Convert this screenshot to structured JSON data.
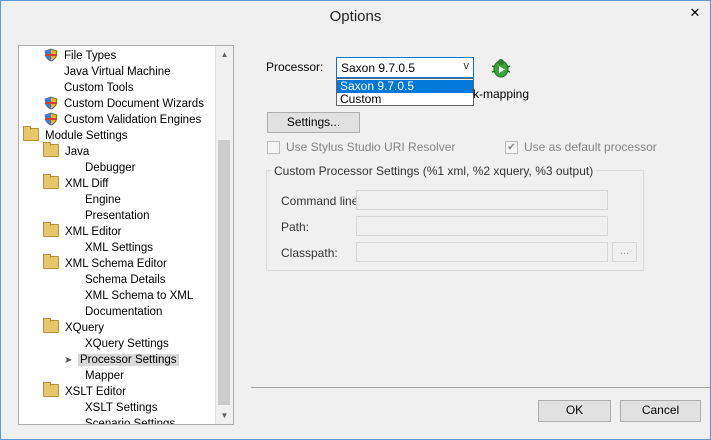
{
  "window": {
    "title": "Options",
    "close_glyph": "✕"
  },
  "tree": {
    "items": [
      {
        "label": "File Types",
        "icon": "shield-icon",
        "indent": 1
      },
      {
        "label": "Java Virtual Machine",
        "icon": "none",
        "indent": 1
      },
      {
        "label": "Custom Tools",
        "icon": "none",
        "indent": 1
      },
      {
        "label": "Custom Document Wizards",
        "icon": "shield-icon",
        "indent": 1
      },
      {
        "label": "Custom Validation Engines",
        "icon": "shield-icon",
        "indent": 1
      },
      {
        "label": "Module Settings",
        "icon": "folder-icon",
        "indent": 0
      },
      {
        "label": "Java",
        "icon": "folder-icon",
        "indent": 1
      },
      {
        "label": "Debugger",
        "icon": "none",
        "indent": 2
      },
      {
        "label": "XML Diff",
        "icon": "folder-icon",
        "indent": 1
      },
      {
        "label": "Engine",
        "icon": "none",
        "indent": 2
      },
      {
        "label": "Presentation",
        "icon": "none",
        "indent": 2
      },
      {
        "label": "XML Editor",
        "icon": "folder-icon",
        "indent": 1
      },
      {
        "label": "XML Settings",
        "icon": "none",
        "indent": 2
      },
      {
        "label": "XML Schema Editor",
        "icon": "folder-icon",
        "indent": 1
      },
      {
        "label": "Schema Details",
        "icon": "none",
        "indent": 2
      },
      {
        "label": "XML Schema to XML",
        "icon": "none",
        "indent": 2
      },
      {
        "label": "Documentation",
        "icon": "none",
        "indent": 2
      },
      {
        "label": "XQuery",
        "icon": "folder-icon",
        "indent": 1
      },
      {
        "label": "XQuery Settings",
        "icon": "none",
        "indent": 2
      },
      {
        "label": "Processor Settings",
        "icon": "arrow-icon",
        "indent": 2,
        "selected": true
      },
      {
        "label": "Mapper",
        "icon": "none",
        "indent": 2
      },
      {
        "label": "XSLT Editor",
        "icon": "folder-icon",
        "indent": 1
      },
      {
        "label": "XSLT Settings",
        "icon": "none",
        "indent": 2
      },
      {
        "label": "Scenario Settings",
        "icon": "none",
        "indent": 2
      }
    ]
  },
  "processor": {
    "label": "Processor:",
    "selected": "Saxon 9.7.0.5",
    "options": [
      "Saxon 9.7.0.5",
      "Custom"
    ],
    "highlighted": "Saxon 9.7.0.5",
    "mapping_label": "k-mapping"
  },
  "settings_button": "Settings...",
  "checkboxes": {
    "uri_resolver": {
      "label": "Use Stylus Studio URI Resolver",
      "checked": false
    },
    "default_processor": {
      "label": "Use as default processor",
      "checked": true
    }
  },
  "custom_group": {
    "title": "Custom Processor Settings (%1 xml, %2 xquery, %3 output)",
    "command_line_label": "Command line:",
    "path_label": "Path:",
    "classpath_label": "Classpath:",
    "browse_label": "..."
  },
  "footer": {
    "ok": "OK",
    "cancel": "Cancel"
  },
  "colors": {
    "accent": "#0078d7",
    "window_border": "#5b9bd5",
    "bug_green": "#3aa33a"
  }
}
